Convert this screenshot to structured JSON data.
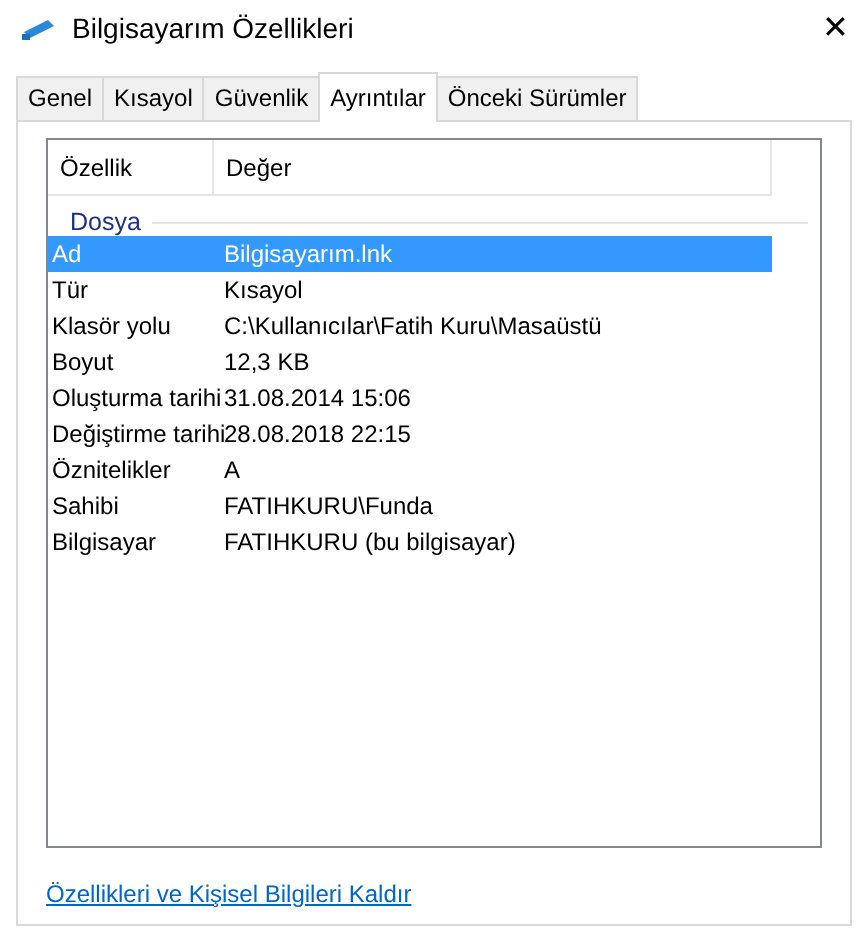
{
  "window": {
    "title": "Bilgisayarım Özellikleri",
    "close": "✕"
  },
  "tabs": [
    {
      "label": "Genel",
      "selected": false
    },
    {
      "label": "Kısayol",
      "selected": false
    },
    {
      "label": "Güvenlik",
      "selected": false
    },
    {
      "label": "Ayrıntılar",
      "selected": true
    },
    {
      "label": "Önceki Sürümler",
      "selected": false
    }
  ],
  "table": {
    "columns": [
      "Özellik",
      "Değer"
    ],
    "group": "Dosya",
    "rows": [
      {
        "property": "Ad",
        "value": "Bilgisayarım.lnk",
        "selected": true
      },
      {
        "property": "Tür",
        "value": "Kısayol",
        "selected": false
      },
      {
        "property": "Klasör yolu",
        "value": "C:\\Kullanıcılar\\Fatih Kuru\\Masaüstü",
        "selected": false
      },
      {
        "property": "Boyut",
        "value": "12,3 KB",
        "selected": false
      },
      {
        "property": "Oluşturma tarihi",
        "value": "31.08.2014 15:06",
        "selected": false
      },
      {
        "property": "Değiştirme tarihi",
        "value": "28.08.2018 22:15",
        "selected": false
      },
      {
        "property": "Öznitelikler",
        "value": "A",
        "selected": false
      },
      {
        "property": "Sahibi",
        "value": "FATIHKURU\\Funda",
        "selected": false
      },
      {
        "property": "Bilgisayar",
        "value": "FATIHKURU (bu bilgisayar)",
        "selected": false
      }
    ]
  },
  "link": "Özellikleri ve Kişisel Bilgileri Kaldır"
}
